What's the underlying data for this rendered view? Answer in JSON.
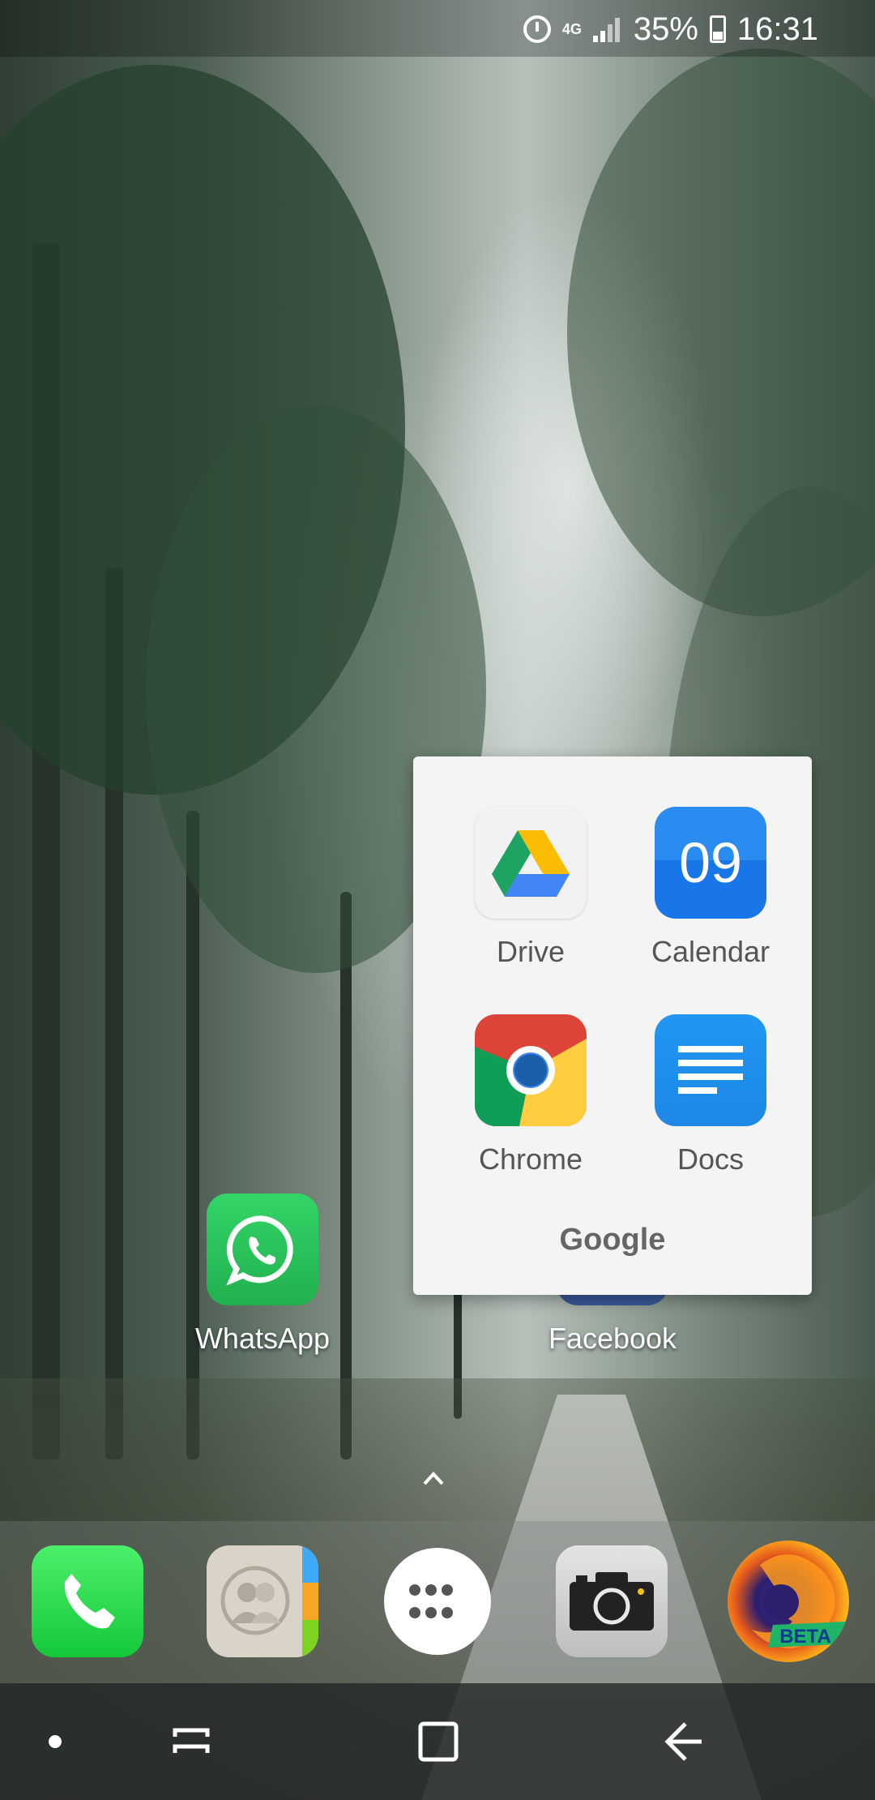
{
  "status_bar": {
    "network": "4G",
    "battery": "35%",
    "time": "16:31",
    "icons": [
      "alarm-icon",
      "signal-icon",
      "battery-icon"
    ]
  },
  "home": {
    "apps": [
      {
        "label": "WhatsApp",
        "icon": "whatsapp-icon"
      },
      {
        "label": "Facebook",
        "icon": "facebook-icon"
      }
    ]
  },
  "folder": {
    "name": "Google",
    "apps": [
      {
        "label": "Drive",
        "icon": "drive-icon"
      },
      {
        "label": "Calendar",
        "icon": "calendar-icon",
        "date": "09"
      },
      {
        "label": "Chrome",
        "icon": "chrome-icon"
      },
      {
        "label": "Docs",
        "icon": "docs-icon"
      }
    ]
  },
  "dock": {
    "apps": [
      "phone-icon",
      "contacts-icon",
      "apps-grid-icon",
      "camera-icon",
      "firefox-beta-icon"
    ],
    "firefox_badge": "BETA"
  },
  "nav": [
    "recents-dot-icon",
    "recent-apps-icon",
    "home-icon",
    "back-icon"
  ],
  "colors": {
    "whatsapp": "#25d366",
    "facebook": "#3b5998",
    "calendar": "#1976e8",
    "docs": "#2196f3",
    "phone": "#14c83a"
  }
}
